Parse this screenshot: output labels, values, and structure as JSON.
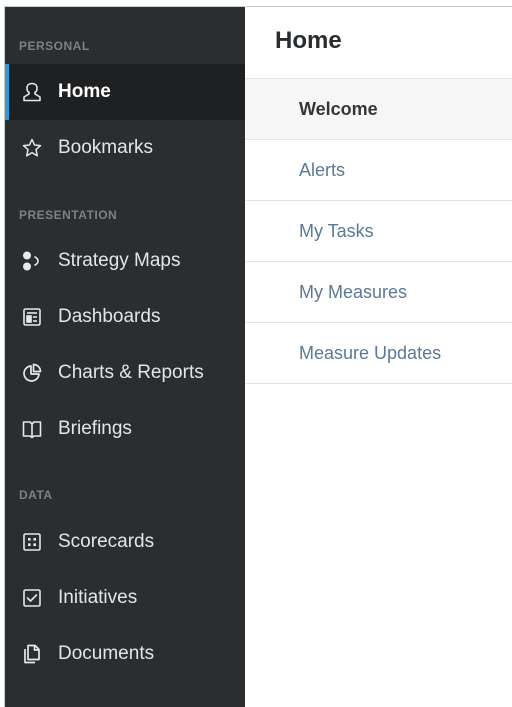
{
  "sidebar": {
    "sections": [
      {
        "label": "PERSONAL",
        "items": [
          {
            "label": "Home",
            "icon": "user-icon",
            "active": true
          },
          {
            "label": "Bookmarks",
            "icon": "star-icon",
            "active": false
          }
        ]
      },
      {
        "label": "PRESENTATION",
        "items": [
          {
            "label": "Strategy Maps",
            "icon": "strategy-map-icon",
            "active": false
          },
          {
            "label": "Dashboards",
            "icon": "dashboard-icon",
            "active": false
          },
          {
            "label": "Charts & Reports",
            "icon": "pie-chart-icon",
            "active": false
          },
          {
            "label": "Briefings",
            "icon": "book-icon",
            "active": false
          }
        ]
      },
      {
        "label": "DATA",
        "items": [
          {
            "label": "Scorecards",
            "icon": "scorecard-icon",
            "active": false
          },
          {
            "label": "Initiatives",
            "icon": "checkbox-icon",
            "active": false
          },
          {
            "label": "Documents",
            "icon": "documents-icon",
            "active": false
          }
        ]
      }
    ]
  },
  "main": {
    "title": "Home",
    "menu": [
      {
        "label": "Welcome",
        "active": true
      },
      {
        "label": "Alerts",
        "active": false
      },
      {
        "label": "My Tasks",
        "active": false
      },
      {
        "label": "My Measures",
        "active": false
      },
      {
        "label": "Measure Updates",
        "active": false
      }
    ]
  },
  "colors": {
    "sidebar_bg": "#2b2e31",
    "active_item_bg": "#1e2022",
    "accent": "#2f97d4",
    "link": "#5b7896"
  }
}
